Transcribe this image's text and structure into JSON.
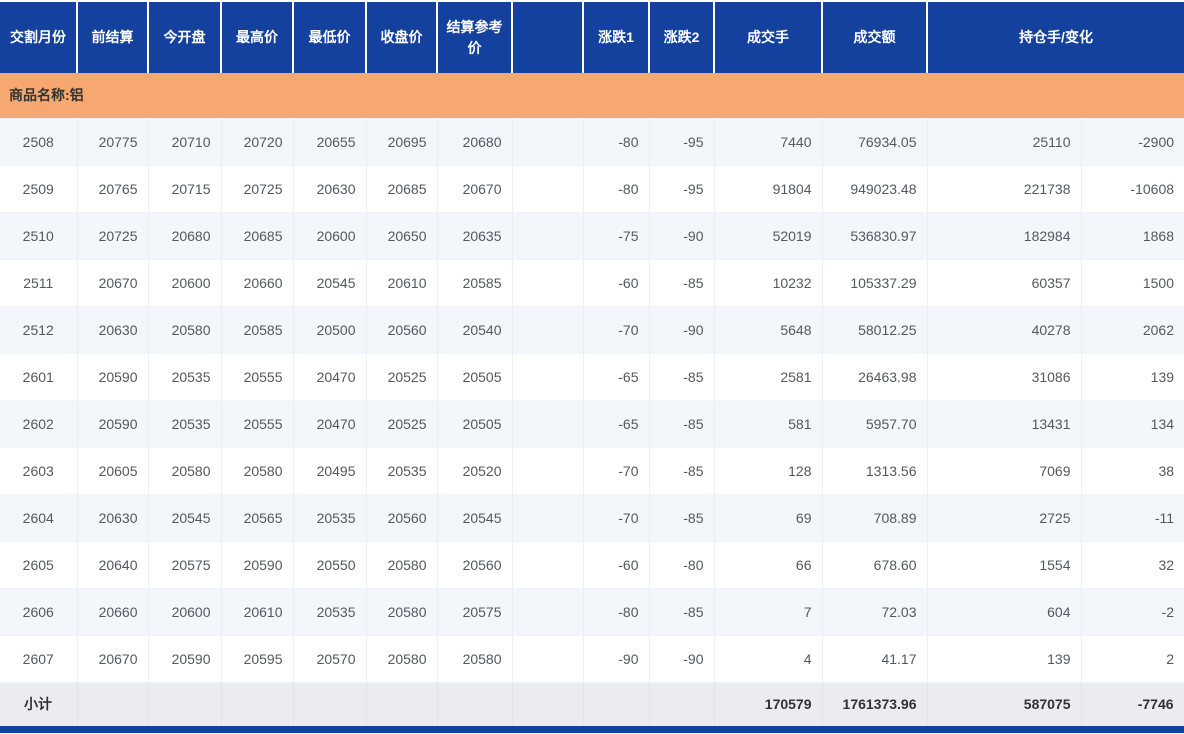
{
  "colors": {
    "header_blue": "#14409E",
    "group_orange": "#F6A870",
    "stripe": "#F3F6FB",
    "subtotal_gray": "#EBECF0",
    "data_text": "#55585F"
  },
  "table": {
    "columns": [
      {
        "key": "month",
        "label": "交割月份"
      },
      {
        "key": "prev_settle",
        "label": "前结算"
      },
      {
        "key": "open",
        "label": "今开盘"
      },
      {
        "key": "high",
        "label": "最高价"
      },
      {
        "key": "low",
        "label": "最低价"
      },
      {
        "key": "close",
        "label": "收盘价"
      },
      {
        "key": "settle_ref",
        "label": "结算参考价"
      },
      {
        "key": "spacer",
        "label": ""
      },
      {
        "key": "chg1",
        "label": "涨跌1"
      },
      {
        "key": "chg2",
        "label": "涨跌2"
      },
      {
        "key": "volume",
        "label": "成交手"
      },
      {
        "key": "turnover",
        "label": "成交额"
      },
      {
        "key": "oi_and_change",
        "label": "持仓手/变化"
      }
    ],
    "cell_keys": [
      "month",
      "prev_settle",
      "open",
      "high",
      "low",
      "close",
      "settle_ref",
      "spacer",
      "chg1",
      "chg2",
      "volume",
      "turnover",
      "oi",
      "oi_change"
    ],
    "group_row": {
      "label": "商品名称:铝"
    },
    "rows": [
      [
        "2508",
        "20775",
        "20710",
        "20720",
        "20655",
        "20695",
        "20680",
        "",
        "-80",
        "-95",
        "7440",
        "76934.05",
        "25110",
        "-2900"
      ],
      [
        "2509",
        "20765",
        "20715",
        "20725",
        "20630",
        "20685",
        "20670",
        "",
        "-80",
        "-95",
        "91804",
        "949023.48",
        "221738",
        "-10608"
      ],
      [
        "2510",
        "20725",
        "20680",
        "20685",
        "20600",
        "20650",
        "20635",
        "",
        "-75",
        "-90",
        "52019",
        "536830.97",
        "182984",
        "1868"
      ],
      [
        "2511",
        "20670",
        "20600",
        "20660",
        "20545",
        "20610",
        "20585",
        "",
        "-60",
        "-85",
        "10232",
        "105337.29",
        "60357",
        "1500"
      ],
      [
        "2512",
        "20630",
        "20580",
        "20585",
        "20500",
        "20560",
        "20540",
        "",
        "-70",
        "-90",
        "5648",
        "58012.25",
        "40278",
        "2062"
      ],
      [
        "2601",
        "20590",
        "20535",
        "20555",
        "20470",
        "20525",
        "20505",
        "",
        "-65",
        "-85",
        "2581",
        "26463.98",
        "31086",
        "139"
      ],
      [
        "2602",
        "20590",
        "20535",
        "20555",
        "20470",
        "20525",
        "20505",
        "",
        "-65",
        "-85",
        "581",
        "5957.70",
        "13431",
        "134"
      ],
      [
        "2603",
        "20605",
        "20580",
        "20580",
        "20495",
        "20535",
        "20520",
        "",
        "-70",
        "-85",
        "128",
        "1313.56",
        "7069",
        "38"
      ],
      [
        "2604",
        "20630",
        "20545",
        "20565",
        "20535",
        "20560",
        "20545",
        "",
        "-70",
        "-85",
        "69",
        "708.89",
        "2725",
        "-11"
      ],
      [
        "2605",
        "20640",
        "20575",
        "20590",
        "20550",
        "20580",
        "20560",
        "",
        "-60",
        "-80",
        "66",
        "678.60",
        "1554",
        "32"
      ],
      [
        "2606",
        "20660",
        "20600",
        "20610",
        "20535",
        "20580",
        "20575",
        "",
        "-80",
        "-85",
        "7",
        "72.03",
        "604",
        "-2"
      ],
      [
        "2607",
        "20670",
        "20590",
        "20595",
        "20570",
        "20580",
        "20580",
        "",
        "-90",
        "-90",
        "4",
        "41.17",
        "139",
        "2"
      ]
    ],
    "subtotal_row": [
      "小计",
      "",
      "",
      "",
      "",
      "",
      "",
      "",
      "",
      "",
      "170579",
      "1761373.96",
      "587075",
      "-7746"
    ]
  }
}
